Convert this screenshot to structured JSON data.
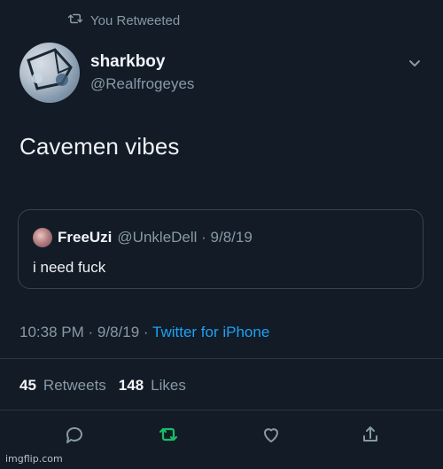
{
  "context": {
    "retweet_label": "You Retweeted"
  },
  "user": {
    "display_name": "sharkboy",
    "handle": "@Realfrogeyes"
  },
  "tweet": {
    "text": "Cavemen vibes",
    "time": "10:38 PM",
    "date": "9/8/19",
    "separator": "·",
    "source": "Twitter for iPhone"
  },
  "quote": {
    "display_name": "FreeUzi",
    "meta": "@UnkleDell · 9/8/19",
    "text": "i need fuck"
  },
  "stats": {
    "retweets_count": "45",
    "retweets_label": "Retweets",
    "likes_count": "148",
    "likes_label": "Likes"
  },
  "actions": {
    "reply_icon": "reply-icon",
    "retweet_icon": "retweet-icon",
    "like_icon": "heart-icon",
    "share_icon": "share-icon"
  },
  "watermark": {
    "text": "imgflip.com"
  },
  "colors": {
    "background": "#121b26",
    "accent": "#1da1f2",
    "retweet_green": "#17bf63",
    "muted": "#8899a6"
  }
}
